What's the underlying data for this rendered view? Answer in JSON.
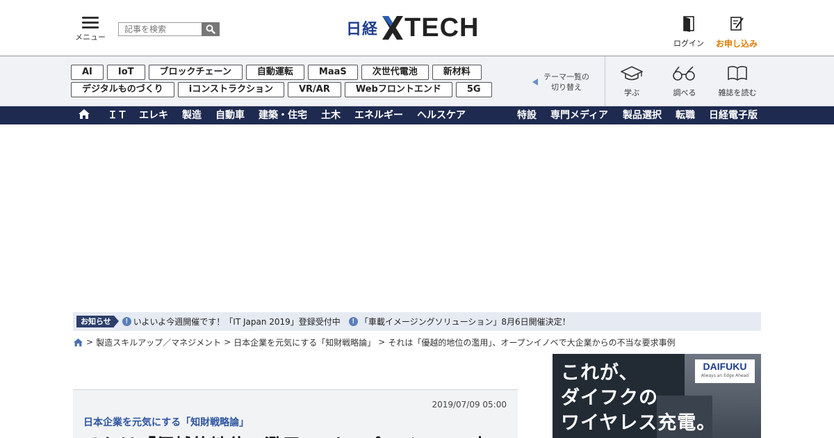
{
  "header": {
    "menu_label": "メニュー",
    "search_placeholder": "記事を検索",
    "logo_nikkei": "日経",
    "logo_xtech": "TECH",
    "login_label": "ログイン",
    "apply_label": "お申し込み"
  },
  "themes": {
    "row1": [
      "AI",
      "IoT",
      "ブロックチェーン",
      "自動運転",
      "MaaS",
      "次世代電池",
      "新材料"
    ],
    "row2": [
      "デジタルものづくり",
      "iコンストラクション",
      "VR/AR",
      "Webフロントエンド",
      "5G"
    ],
    "switch_label_1": "テーマ一覧の",
    "switch_label_2": "切り替え"
  },
  "tools": {
    "learn": "学ぶ",
    "research": "調べる",
    "magazine": "雑誌を読む"
  },
  "catnav": {
    "left": [
      "ＩＴ",
      "エレキ",
      "製造",
      "自動車",
      "建築・住宅",
      "土木",
      "エネルギー",
      "ヘルスケア"
    ],
    "right": [
      "特設",
      "専門メディア",
      "製品選択",
      "転職",
      "日経電子版"
    ]
  },
  "notice": {
    "badge": "お知らせ",
    "items": [
      "いよいよ今週開催です！「IT Japan 2019」登録受付中",
      "「車載イメージングソリューション」8月6日開催決定！"
    ]
  },
  "breadcrumb": [
    "製造スキルアップ／マネジメント",
    "日本企業を元気にする「知財戦略論」",
    "それは「優越的地位の濫用」、オープンイノベで大企業からの不当な要求事例"
  ],
  "article": {
    "date": "2019/07/09 05:00",
    "series": "日本企業を元気にする「知財戦略論」",
    "headline": "それは「優越的地位の濫用」、オープンイノベで大"
  },
  "ad": {
    "brand": "DAIFUKU",
    "tagline": "Always an Edge Ahead",
    "line1": "これが、",
    "line2": "ダイフクの",
    "line3": "ワイヤレス充電。"
  },
  "colors": {
    "brand_navy": "#1e2a4f",
    "logo_blue": "#1f3e8c",
    "apply_orange": "#e07b00",
    "link_blue": "#2f56a0"
  },
  "icons": [
    "menu-icon",
    "search-icon",
    "login-door-icon",
    "apply-form-icon",
    "graduation-cap-icon",
    "binoculars-icon",
    "open-book-icon",
    "home-icon",
    "info-icon",
    "triangle-left-icon"
  ]
}
